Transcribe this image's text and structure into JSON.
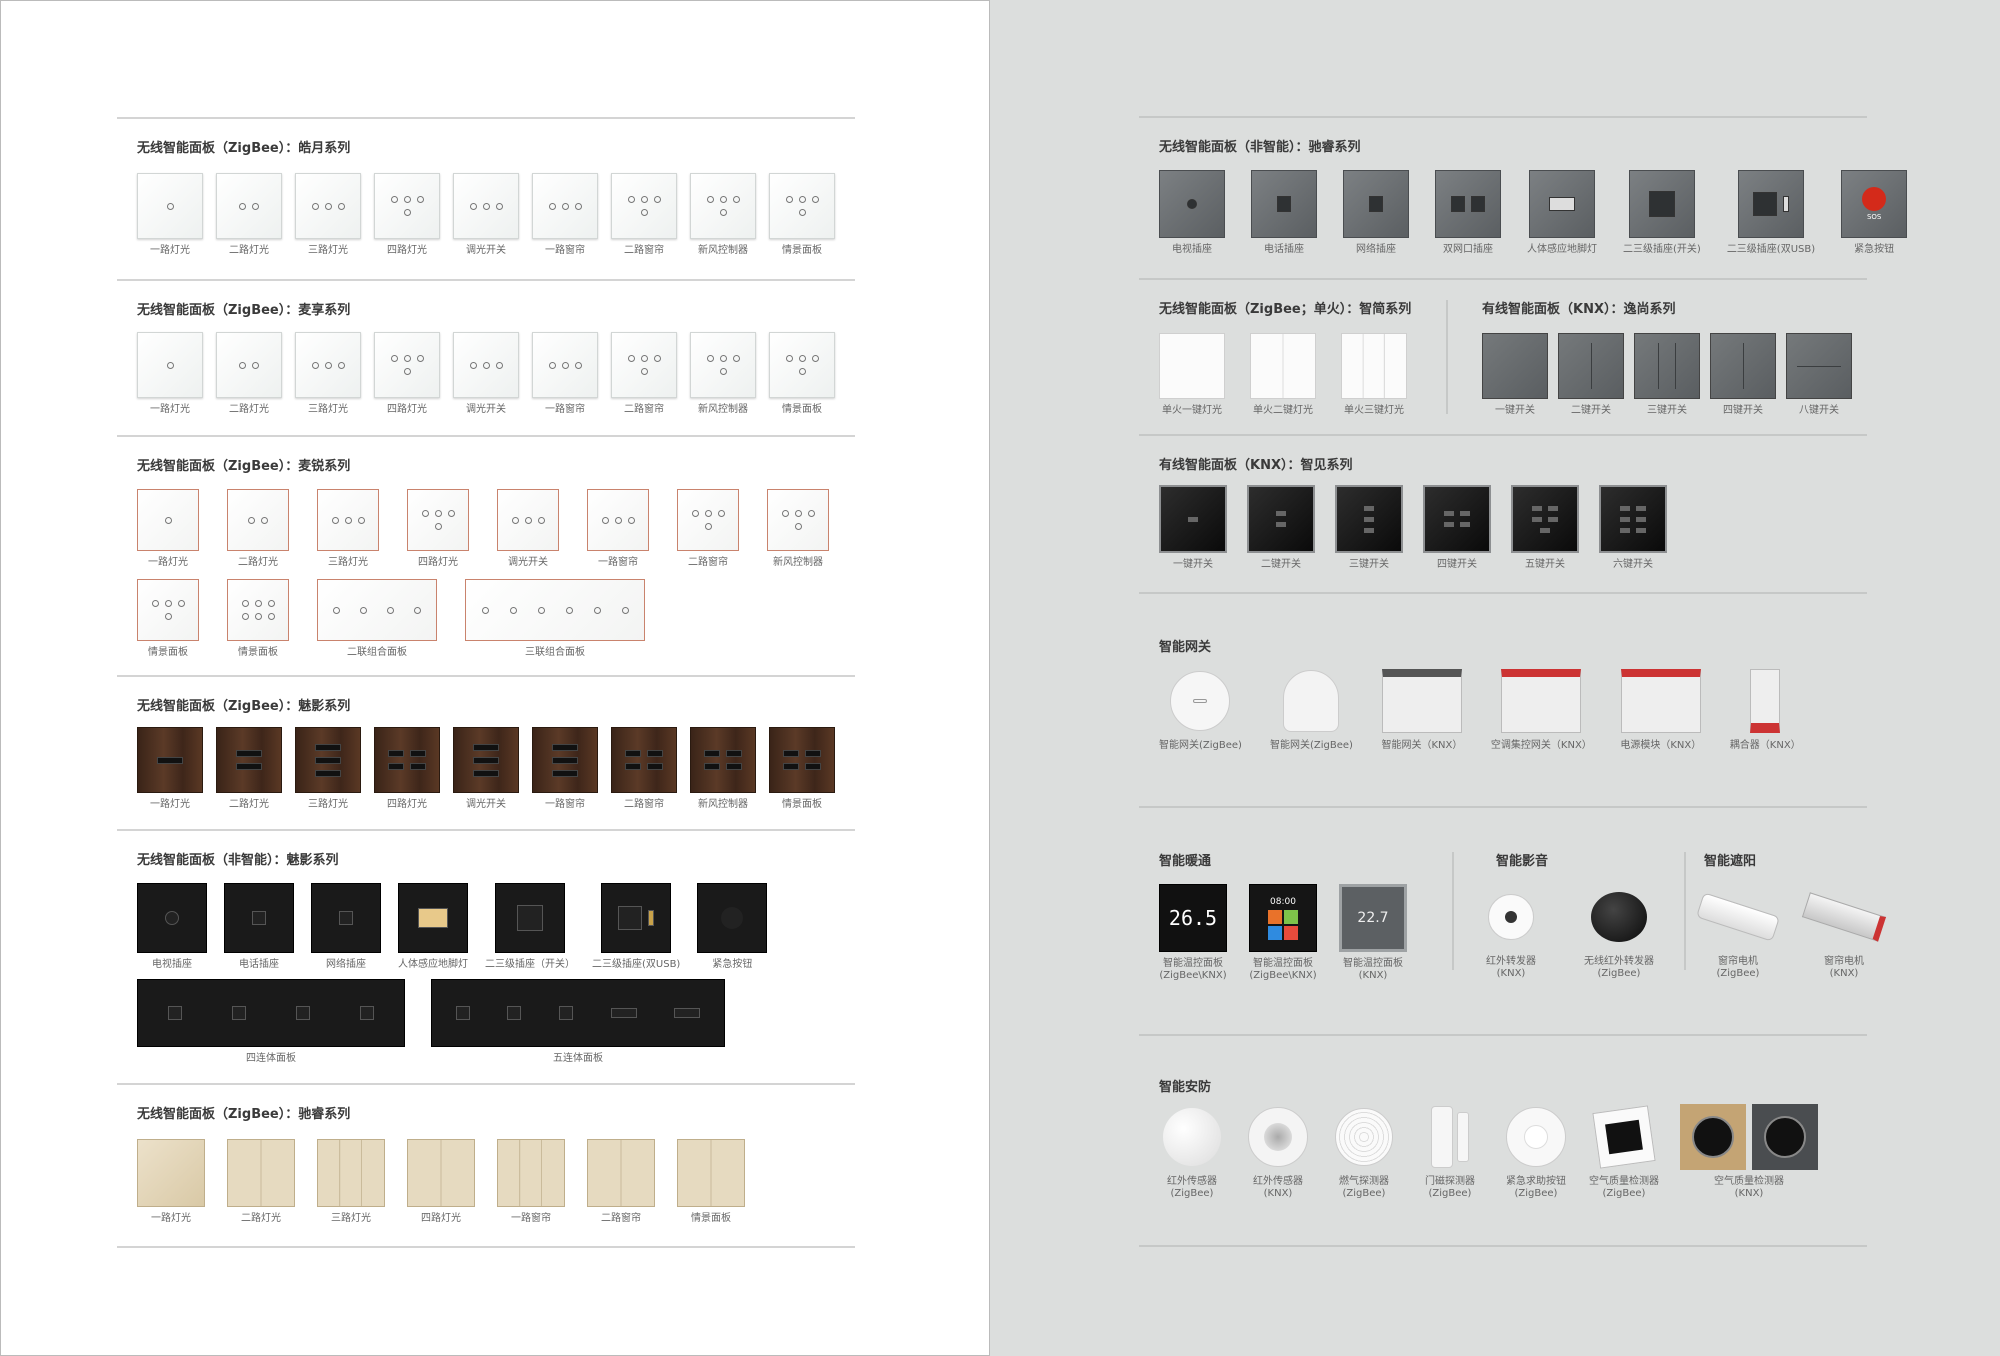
{
  "left": {
    "sections": [
      {
        "title": "无线智能面板（ZigBee）：皓月系列",
        "items": [
          "一路灯光",
          "二路灯光",
          "三路灯光",
          "四路灯光",
          "调光开关",
          "一路窗帘",
          "二路窗帘",
          "新风控制器",
          "情景面板"
        ]
      },
      {
        "title": "无线智能面板（ZigBee）：麦享系列",
        "items": [
          "一路灯光",
          "二路灯光",
          "三路灯光",
          "四路灯光",
          "调光开关",
          "一路窗帘",
          "二路窗帘",
          "新风控制器",
          "情景面板"
        ]
      },
      {
        "title": "无线智能面板（ZigBee）：麦锐系列",
        "items": [
          "一路灯光",
          "二路灯光",
          "三路灯光",
          "四路灯光",
          "调光开关",
          "一路窗帘",
          "二路窗帘",
          "新风控制器"
        ],
        "items2": [
          "情景面板",
          "情景面板",
          "二联组合面板",
          "三联组合面板"
        ]
      },
      {
        "title": "无线智能面板（ZigBee）：魅影系列",
        "items": [
          "一路灯光",
          "二路灯光",
          "三路灯光",
          "四路灯光",
          "调光开关",
          "一路窗帘",
          "二路窗帘",
          "新风控制器",
          "情景面板"
        ]
      },
      {
        "title": "无线智能面板（非智能）：魅影系列",
        "items": [
          "电视插座",
          "电话插座",
          "网络插座",
          "人体感应地脚灯",
          "二三级插座（开关）",
          "二三级插座(双USB)",
          "紧急按钮"
        ],
        "items2": [
          "四连体面板",
          "五连体面板"
        ]
      },
      {
        "title": "无线智能面板（ZigBee）：驰睿系列",
        "items": [
          "一路灯光",
          "二路灯光",
          "三路灯光",
          "四路灯光",
          "一路窗帘",
          "二路窗帘",
          "情景面板"
        ]
      }
    ]
  },
  "right": {
    "chirui": {
      "title": "无线智能面板（非智能）：驰睿系列",
      "items": [
        "电视插座",
        "电话插座",
        "网络插座",
        "双网口插座",
        "人体感应地脚灯",
        "二三级插座(开关)",
        "二三级插座(双USB)",
        "紧急按钮"
      ]
    },
    "zhijian": {
      "title": "无线智能面板（ZigBee；单火）：智简系列",
      "items": [
        "单火一键灯光",
        "单火二键灯光",
        "单火三键灯光"
      ]
    },
    "yishang": {
      "title": "有线智能面板（KNX）：逸尚系列",
      "items": [
        "一键开关",
        "二键开关",
        "三键开关",
        "四键开关",
        "八键开关"
      ]
    },
    "zhijian2": {
      "title": "有线智能面板（KNX）：智见系列",
      "items": [
        "一键开关",
        "二键开关",
        "三键开关",
        "四键开关",
        "五键开关",
        "六键开关"
      ]
    },
    "gateway": {
      "title": "智能网关",
      "items": [
        "智能网关(ZigBee)",
        "智能网关(ZigBee)",
        "智能网关（KNX）",
        "空调集控网关（KNX）",
        "电源模块（KNX）",
        "耦合器（KNX）"
      ]
    },
    "hvac": {
      "title": "智能暖通",
      "items": [
        [
          "智能温控面板",
          "(ZigBee\\KNX)"
        ],
        [
          "智能温控面板",
          "(ZigBee\\KNX)"
        ],
        [
          "智能温控面板",
          "(KNX)"
        ]
      ],
      "display": "26.5",
      "display2": "22.7",
      "clock": "08:00"
    },
    "av": {
      "title": "智能影音",
      "items": [
        [
          "红外转发器",
          "(KNX)"
        ],
        [
          "无线红外转发器",
          "(ZigBee)"
        ]
      ]
    },
    "shade": {
      "title": "智能遮阳",
      "items": [
        [
          "窗帘电机",
          "(ZigBee)"
        ],
        [
          "窗帘电机",
          "(KNX)"
        ]
      ]
    },
    "security": {
      "title": "智能安防",
      "items": [
        [
          "红外传感器",
          "(ZigBee)"
        ],
        [
          "红外传感器",
          "(KNX)"
        ],
        [
          "燃气探测器",
          "(ZigBee)"
        ],
        [
          "门磁探测器",
          "(ZigBee)"
        ],
        [
          "紧急求助按钮",
          "(ZigBee)"
        ],
        [
          "空气质量检测器",
          "(ZigBee)"
        ],
        [
          "空气质量检测器",
          "(KNX)"
        ]
      ]
    }
  },
  "sos_label": "SOS",
  "colors": {
    "left_bg": "#ffffff",
    "right_bg": "#dcdedd",
    "sos_red": "#d42a1a"
  }
}
